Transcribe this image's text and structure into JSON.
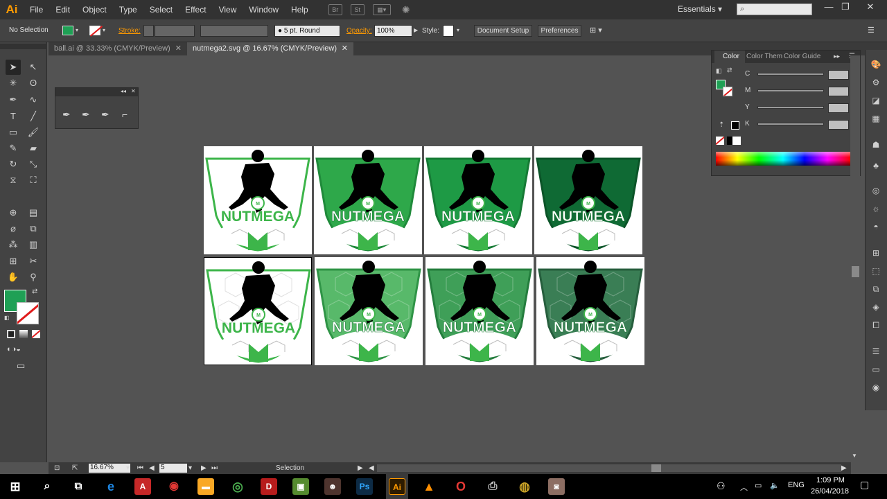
{
  "app": {
    "logo": "Ai",
    "menu": [
      "File",
      "Edit",
      "Object",
      "Type",
      "Select",
      "Effect",
      "View",
      "Window",
      "Help"
    ],
    "menubar_icons": [
      "Br",
      "St"
    ],
    "workspace": "Essentials",
    "search_placeholder": "",
    "window_controls": [
      "—",
      "❐",
      "✕"
    ]
  },
  "control_bar": {
    "selection_state": "No Selection",
    "stroke_label": "Stroke:",
    "brush": "5 pt. Round",
    "opacity_label": "Opacity:",
    "opacity_value": "100%",
    "style_label": "Style:",
    "document_setup": "Document Setup",
    "preferences": "Preferences"
  },
  "tabs": [
    {
      "label": "ball.ai @ 33.33% (CMYK/Preview)",
      "close": "✕"
    },
    {
      "label": "nutmega2.svg @ 16.67% (CMYK/Preview)",
      "close": "✕"
    }
  ],
  "artboards": {
    "brand": "NUTMEGA",
    "badge_letter": "M",
    "variants": [
      {
        "fill": "#ffffff",
        "stroke": "#3db54a",
        "row": 1
      },
      {
        "fill": "#2ea84a",
        "stroke": "#1f8a3a",
        "row": 1
      },
      {
        "fill": "#1e9a45",
        "stroke": "#167a35",
        "row": 1
      },
      {
        "fill": "#0f6a34",
        "stroke": "#0b5428",
        "row": 1
      },
      {
        "fill": "#ffffff",
        "stroke": "#3db54a",
        "row": 2
      },
      {
        "fill": "#58b96a",
        "stroke": "#2f9446",
        "row": 2
      },
      {
        "fill": "#3f9f58",
        "stroke": "#247d3d",
        "row": 2
      },
      {
        "fill": "#3a7e55",
        "stroke": "#265e3d",
        "row": 2
      }
    ]
  },
  "color_panel": {
    "tabs": [
      "Color",
      "Color Them",
      "Color Guide"
    ],
    "channels": [
      "C",
      "M",
      "Y",
      "K"
    ],
    "unit": "%",
    "fill_color": "#1fa055"
  },
  "status_bar": {
    "zoom": "16.67%",
    "artboard_number": "5",
    "tool_name": "Selection"
  },
  "taskbar": {
    "language": "ENG",
    "time": "1:09 PM",
    "date": "26/04/2018",
    "apps": [
      "Edge",
      "Acrobat",
      "Chrome Canary",
      "File Explorer",
      "Chrome",
      "Dota 2",
      "Minecraft",
      "Game",
      "Photoshop",
      "Illustrator",
      "VLC",
      "Opera",
      "Printer",
      "App",
      "Photo"
    ]
  }
}
